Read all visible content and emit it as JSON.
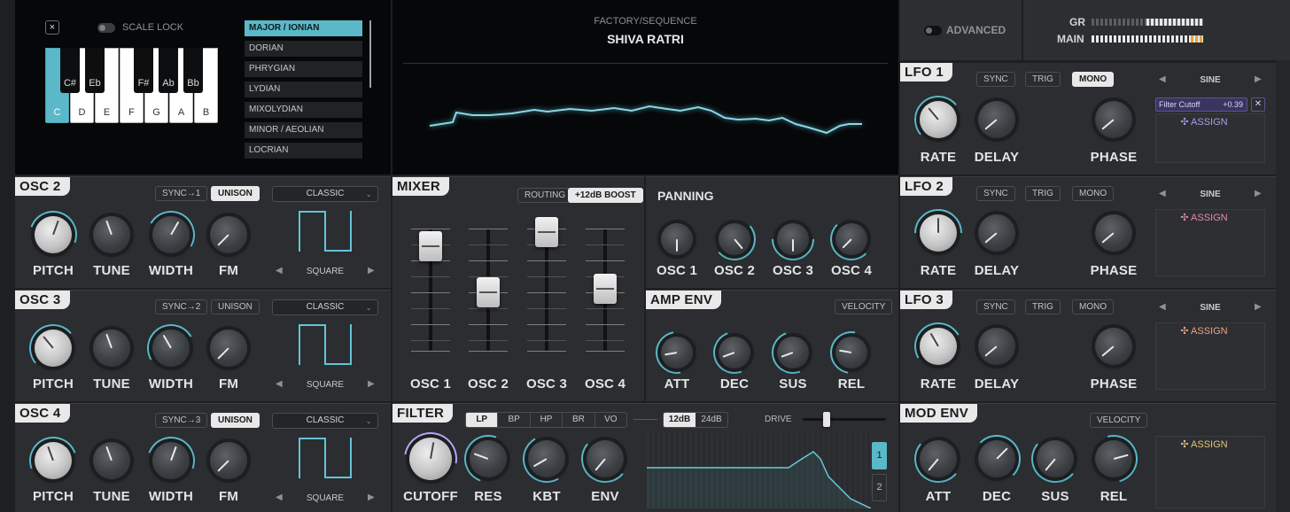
{
  "scale": {
    "close": "×",
    "lock_label": "SCALE LOCK",
    "white_keys": [
      "C",
      "D",
      "E",
      "F",
      "G",
      "A",
      "B"
    ],
    "black_keys": [
      "C#",
      "Eb",
      "F#",
      "Ab",
      "Bb"
    ],
    "modes": [
      "MAJOR / IONIAN",
      "DORIAN",
      "PHRYGIAN",
      "LYDIAN",
      "MIXOLYDIAN",
      "MINOR / AEOLIAN",
      "LOCRIAN"
    ],
    "selected_mode": 0
  },
  "preset": {
    "category": "FACTORY/SEQUENCE",
    "name": "SHIVA RATRI"
  },
  "topright": {
    "advanced": "ADVANCED",
    "gr": "GR",
    "main": "MAIN"
  },
  "osc2": {
    "title": "OSC 2",
    "sync": "SYNC→1",
    "unison": "UNISON",
    "mode": "CLASSIC",
    "wave": "SQUARE"
  },
  "osc3": {
    "title": "OSC 3",
    "sync": "SYNC→2",
    "unison": "UNISON",
    "mode": "CLASSIC",
    "wave": "SQUARE"
  },
  "osc4": {
    "title": "OSC 4",
    "sync": "SYNC→3",
    "unison": "UNISON",
    "mode": "CLASSIC",
    "wave": "SQUARE"
  },
  "osc_knobs": [
    "PITCH",
    "TUNE",
    "WIDTH",
    "FM"
  ],
  "mixer": {
    "title": "MIXER",
    "routing": "ROUTING",
    "boost": "+12dB BOOST",
    "channels": [
      "OSC 1",
      "OSC 2",
      "OSC 3",
      "OSC 4"
    ]
  },
  "panning": {
    "title": "PANNING",
    "channels": [
      "OSC 1",
      "OSC 2",
      "OSC 3",
      "OSC 4"
    ]
  },
  "ampenv": {
    "title": "AMP ENV",
    "velocity": "VELOCITY",
    "knobs": [
      "ATT",
      "DEC",
      "SUS",
      "REL"
    ]
  },
  "filter": {
    "title": "FILTER",
    "types": [
      "LP",
      "BP",
      "HP",
      "BR",
      "VO"
    ],
    "slopes": [
      "12dB",
      "24dB"
    ],
    "drive": "DRIVE",
    "knobs": [
      "CUTOFF",
      "RES",
      "KBT",
      "ENV"
    ],
    "tabs": [
      "1",
      "2"
    ]
  },
  "lfo1": {
    "title": "LFO 1",
    "sync": "SYNC",
    "trig": "TRIG",
    "mono": "MONO",
    "shape": "SINE",
    "knobs": [
      "RATE",
      "DELAY",
      "PHASE"
    ],
    "mod_target": "Filter Cutoff",
    "mod_amount": "+0.39",
    "assign": "ASSIGN"
  },
  "lfo2": {
    "title": "LFO 2",
    "sync": "SYNC",
    "trig": "TRIG",
    "mono": "MONO",
    "shape": "SINE",
    "knobs": [
      "RATE",
      "DELAY",
      "PHASE"
    ],
    "assign": "ASSIGN"
  },
  "lfo3": {
    "title": "LFO 3",
    "sync": "SYNC",
    "trig": "TRIG",
    "mono": "MONO",
    "shape": "SINE",
    "knobs": [
      "RATE",
      "DELAY",
      "PHASE"
    ],
    "assign": "ASSIGN"
  },
  "modenv": {
    "title": "MOD ENV",
    "velocity": "VELOCITY",
    "knobs": [
      "ATT",
      "DEC",
      "SUS",
      "REL"
    ],
    "assign": "ASSIGN"
  },
  "colors": {
    "accent": "#5ab8c8",
    "lfo1_assign": "#a99cf0",
    "lfo2_assign": "#e88aa8",
    "lfo3_assign": "#f0a08a",
    "modenv_assign": "#e6c27a"
  }
}
